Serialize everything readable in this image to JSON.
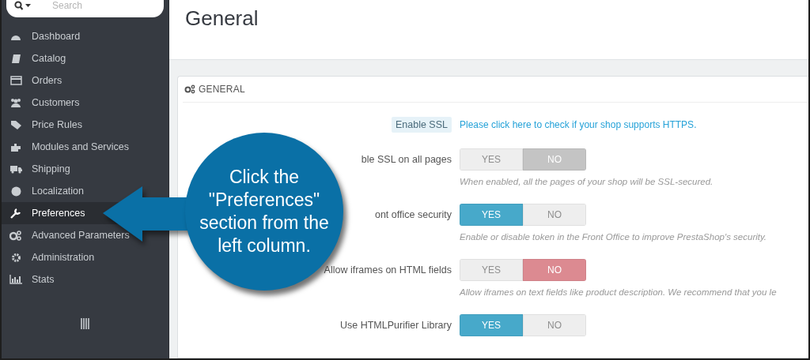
{
  "sidebar": {
    "search": {
      "placeholder": "Search"
    },
    "items": [
      {
        "label": "Dashboard",
        "selected": false
      },
      {
        "label": "Catalog",
        "selected": false
      },
      {
        "label": "Orders",
        "selected": false
      },
      {
        "label": "Customers",
        "selected": false
      },
      {
        "label": "Price Rules",
        "selected": false
      },
      {
        "label": "Modules and Services",
        "selected": false
      },
      {
        "label": "Shipping",
        "selected": false
      },
      {
        "label": "Localization",
        "selected": false
      },
      {
        "label": "Preferences",
        "selected": true
      },
      {
        "label": "Advanced Parameters",
        "selected": false
      },
      {
        "label": "Administration",
        "selected": false
      },
      {
        "label": "Stats",
        "selected": false
      }
    ]
  },
  "page": {
    "title": "General"
  },
  "panel": {
    "heading": "GENERAL",
    "ssl": {
      "label": "Enable SSL",
      "link": "Please click here to check if your shop supports HTTPS."
    },
    "rows": [
      {
        "label": "ble SSL on all pages",
        "options": [
          {
            "label": "YES",
            "selected": false
          },
          {
            "label": "NO",
            "selected": true
          }
        ],
        "color": "#c4c4c4",
        "help": "When enabled, all the pages of your shop will be SSL-secured."
      },
      {
        "label": "ont office security",
        "options": [
          {
            "label": "YES",
            "selected": true
          },
          {
            "label": "NO",
            "selected": false
          }
        ],
        "color": "#47a9ca",
        "help": "Enable or disable token in the Front Office to improve PrestaShop's security."
      },
      {
        "label": "Allow iframes on HTML fields",
        "options": [
          {
            "label": "YES",
            "selected": false
          },
          {
            "label": "NO",
            "selected": true
          }
        ],
        "color": "#dc8a91",
        "help": "Allow iframes on text fields like product description. We recommend that you le"
      },
      {
        "label": "Use HTMLPurifier Library",
        "options": [
          {
            "label": "YES",
            "selected": true
          },
          {
            "label": "NO",
            "selected": false
          }
        ],
        "color": "#47a9ca"
      }
    ]
  },
  "callout": {
    "text": "Click the \"Preferences\" section from the left column."
  }
}
